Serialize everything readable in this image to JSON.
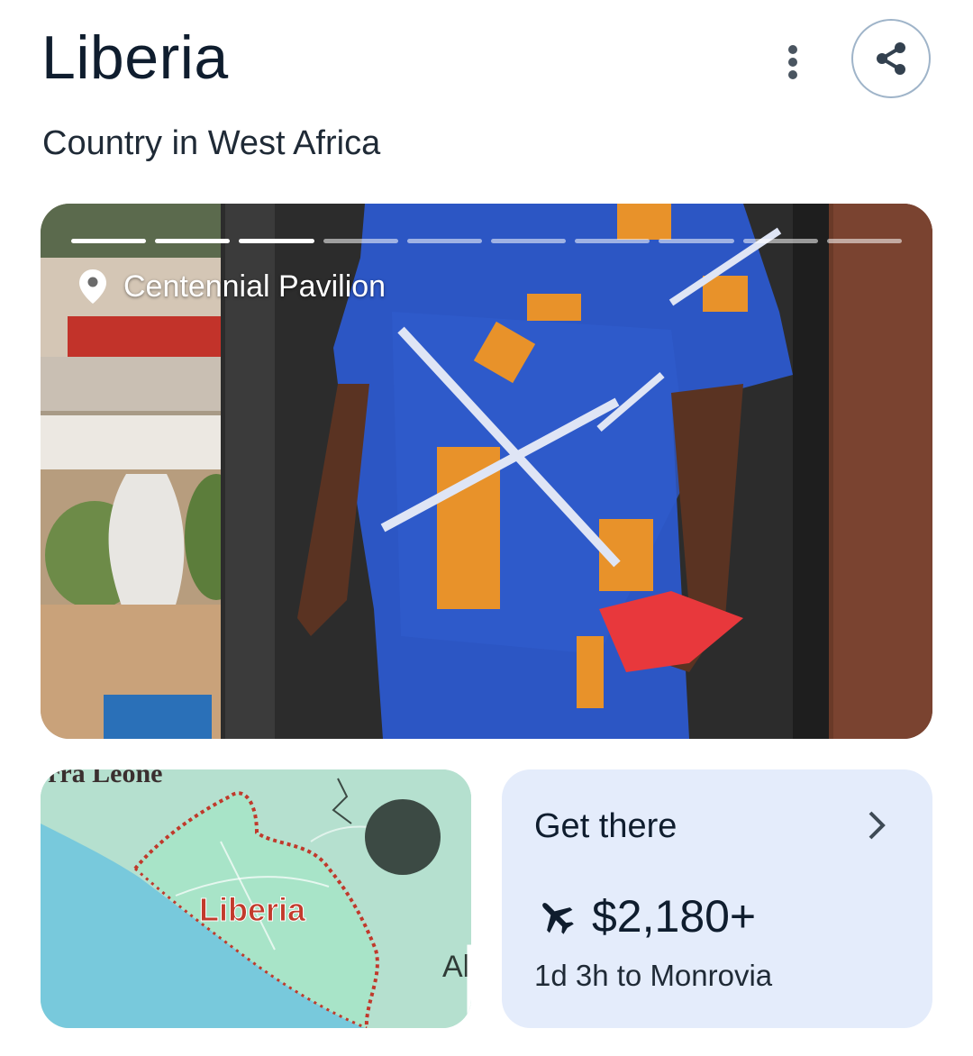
{
  "header": {
    "title": "Liberia",
    "subtitle": "Country in West Africa"
  },
  "actions": {
    "more_icon": "more-vert-icon",
    "share_icon": "share-icon"
  },
  "photo": {
    "location_icon": "location-pin-icon",
    "location": "Centennial Pavilion",
    "story_progress": [
      1,
      1,
      1,
      0,
      0,
      0,
      0,
      0,
      0,
      0
    ]
  },
  "map": {
    "country_label": "Liberia",
    "neighbor_label": "rra Leone",
    "edge_label": "Al",
    "expand_icon": "expand-icon"
  },
  "travel": {
    "title": "Get there",
    "chevron_icon": "chevron-right-icon",
    "flight_icon": "flight-icon",
    "price": "$2,180+",
    "duration": "1d 3h to Monrovia"
  },
  "colors": {
    "map_water": "#78c9dc",
    "map_land": "#a9dcd0",
    "border_red": "#c0392b",
    "label_red": "#c23b2c",
    "travel_card_bg": "#e4ecfb"
  }
}
